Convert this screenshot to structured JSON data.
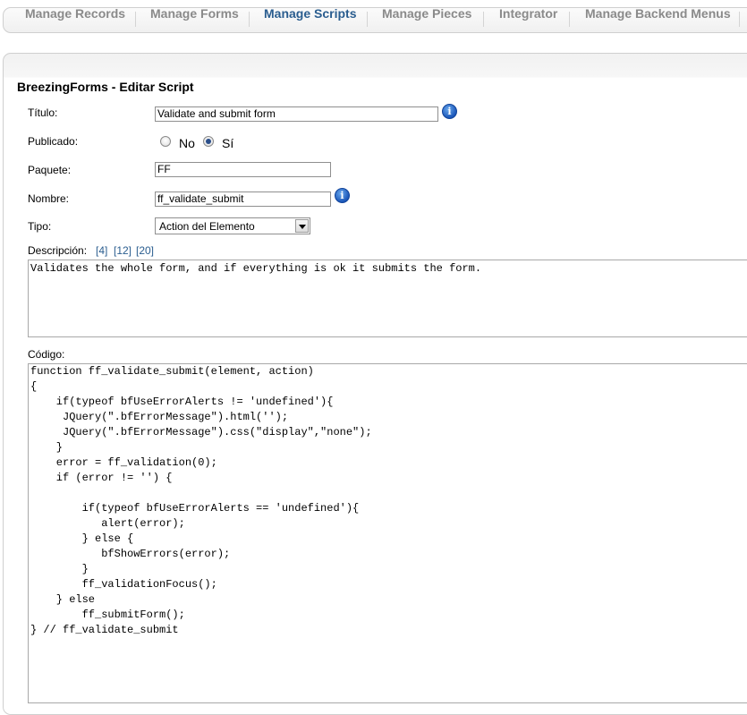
{
  "tabs": [
    {
      "label": "Manage Records",
      "active": false
    },
    {
      "label": "Manage Forms",
      "active": false
    },
    {
      "label": "Manage Scripts",
      "active": true
    },
    {
      "label": "Manage Pieces",
      "active": false
    },
    {
      "label": "Integrator",
      "active": false
    },
    {
      "label": "Manage Backend Menus",
      "active": false
    }
  ],
  "panel": {
    "title": "BreezingForms - Editar Script"
  },
  "form": {
    "titulo": {
      "label": "Título:",
      "value": "Validate and submit form"
    },
    "publicado": {
      "label": "Publicado:",
      "options": [
        "No",
        "Sí"
      ],
      "selected": "Sí"
    },
    "paquete": {
      "label": "Paquete:",
      "value": "FF"
    },
    "nombre": {
      "label": "Nombre:",
      "value": "ff_validate_submit"
    },
    "tipo": {
      "label": "Tipo:",
      "value": "Action del Elemento"
    },
    "descripcion": {
      "label": "Descripción:",
      "size_links": [
        "[4]",
        "[12]",
        "[20]"
      ],
      "value": "Validates the whole form, and if everything is ok it submits the form."
    },
    "codigo": {
      "label": "Código:",
      "value": "function ff_validate_submit(element, action)\n{\n    if(typeof bfUseErrorAlerts != 'undefined'){\n     JQuery(\".bfErrorMessage\").html('');\n     JQuery(\".bfErrorMessage\").css(\"display\",\"none\");\n    }\n    error = ff_validation(0);\n    if (error != '') {\n\n        if(typeof bfUseErrorAlerts == 'undefined'){\n           alert(error);\n        } else {\n           bfShowErrors(error);\n        }\n        ff_validationFocus();\n    } else\n        ff_submitForm();\n} // ff_validate_submit"
    }
  },
  "icons": {
    "info": "info-icon",
    "dropdown": "chevron-down-icon"
  },
  "colors": {
    "active_tab": "#2a5d8f",
    "inactive_tab": "#8a8a8a",
    "link": "#2a5d8f",
    "info_icon": "#1a56b8"
  }
}
